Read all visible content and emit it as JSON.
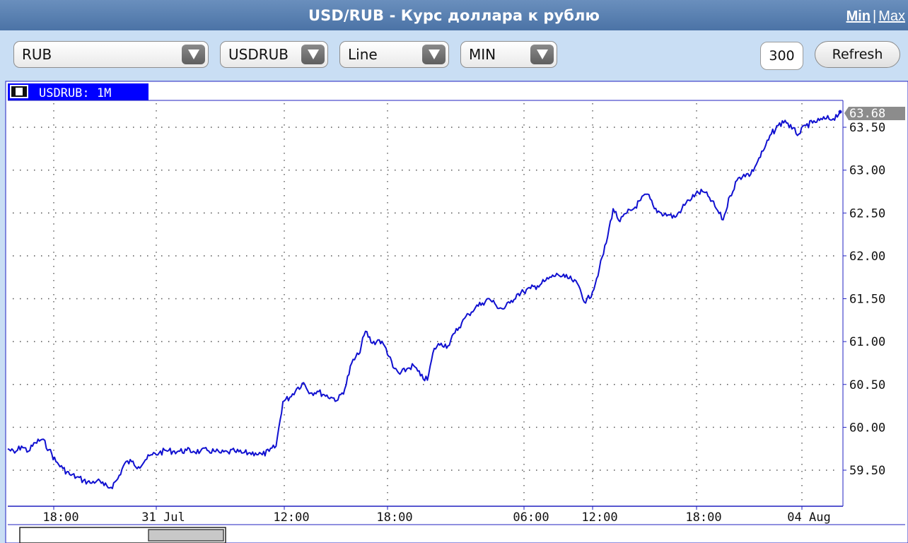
{
  "window": {
    "title": "USD/RUB - Курс доллара к рублю",
    "min_label": "Min",
    "max_label": "Max",
    "separator": "|"
  },
  "toolbar": {
    "currency_select": "RUB",
    "symbol_select": "USDRUB",
    "chart_type_select": "Line",
    "interval_select": "MIN",
    "points_value": "300",
    "refresh_label": "Refresh"
  },
  "colors": {
    "line": "#1010d0",
    "header_bar": "#4b73a6",
    "toolbar_bg": "#c9def4",
    "tab_bg": "#0000ff",
    "last_price_tag": "#8c8c8c"
  },
  "chart_data": {
    "type": "line",
    "title": "USDRUB: 1M",
    "last_price_label": "63.68",
    "ylim": [
      59.1,
      63.75
    ],
    "y_ticks": [
      "59.50",
      "60.00",
      "60.50",
      "61.00",
      "61.50",
      "62.00",
      "62.50",
      "63.00",
      "63.50"
    ],
    "x_tick_labels": [
      "18:00",
      "31 Jul",
      "12:00",
      "18:00",
      "06:00",
      "12:00",
      "18:00",
      "04 Aug"
    ],
    "grid": true,
    "series": [
      {
        "values": [
          59.75,
          59.7,
          59.78,
          59.72,
          59.82,
          59.86,
          59.74,
          59.6,
          59.52,
          59.45,
          59.42,
          59.38,
          59.35,
          59.38,
          59.32,
          59.3,
          59.4,
          59.58,
          59.6,
          59.54,
          59.62,
          59.68,
          59.7,
          59.73,
          59.72,
          59.72,
          59.73,
          59.72,
          59.72,
          59.73,
          59.72,
          59.7,
          59.71,
          59.72,
          59.7,
          59.7,
          59.7,
          59.68,
          59.72,
          59.78,
          60.3,
          60.35,
          60.45,
          60.52,
          60.4,
          60.42,
          60.38,
          60.35,
          60.32,
          60.45,
          60.75,
          60.85,
          61.12,
          60.98,
          61.02,
          60.92,
          60.7,
          60.62,
          60.68,
          60.72,
          60.6,
          60.55,
          60.92,
          60.98,
          60.95,
          61.1,
          61.22,
          61.32,
          61.4,
          61.45,
          61.5,
          61.42,
          61.38,
          61.45,
          61.55,
          61.58,
          61.62,
          61.65,
          61.7,
          61.75,
          61.78,
          61.75,
          61.72,
          61.65,
          61.45,
          61.58,
          61.85,
          62.15,
          62.55,
          62.4,
          62.5,
          62.55,
          62.65,
          62.72,
          62.55,
          62.5,
          62.48,
          62.45,
          62.55,
          62.65,
          62.72,
          62.75,
          62.68,
          62.55,
          62.42,
          62.7,
          62.88,
          62.95,
          62.95,
          63.1,
          63.25,
          63.42,
          63.52,
          63.58,
          63.48,
          63.42,
          63.52,
          63.55,
          63.58,
          63.6,
          63.6,
          63.68
        ]
      }
    ]
  }
}
